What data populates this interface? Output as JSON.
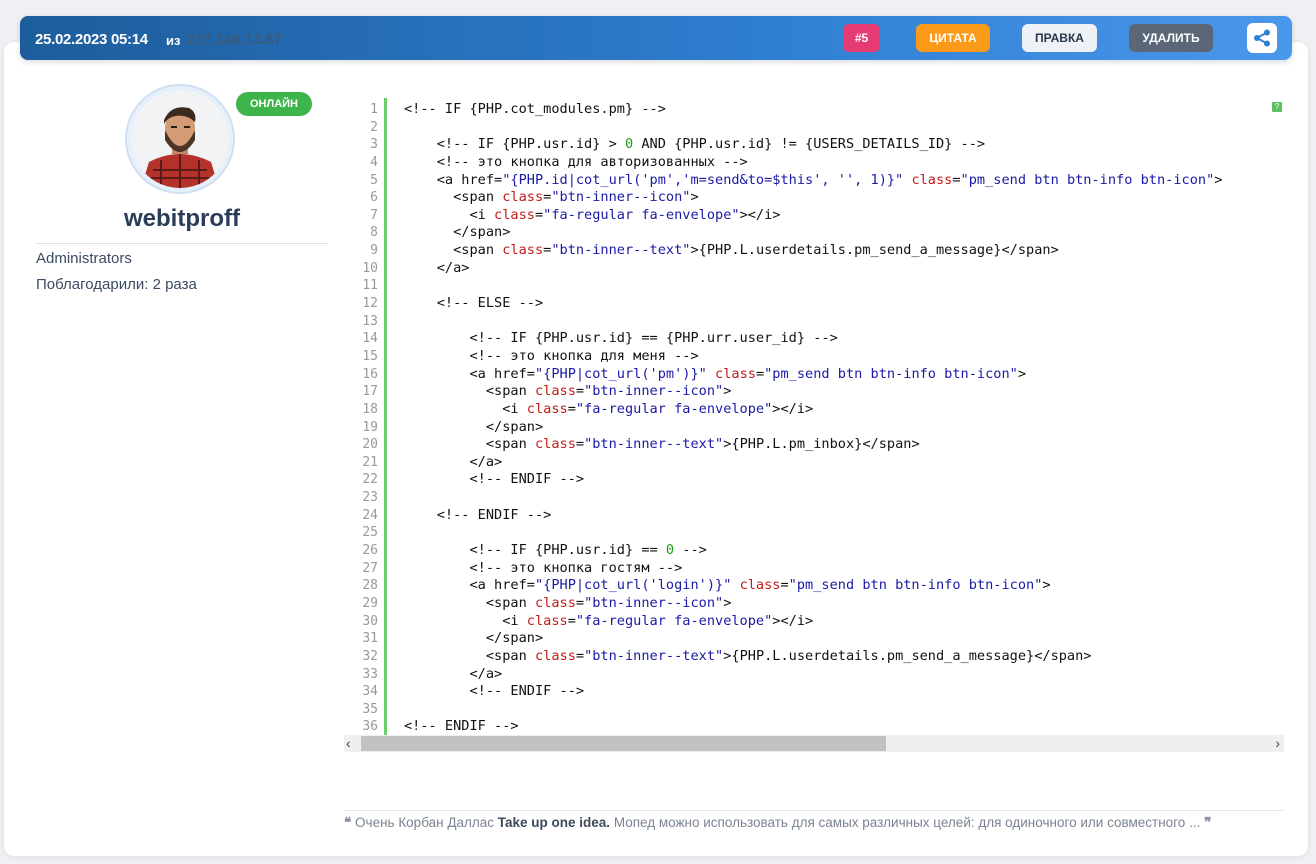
{
  "header": {
    "date": "25.02.2023 05:14",
    "from_label": "из",
    "ip": "217.146.13.87",
    "buttons": {
      "post_number": "#5",
      "quote": "ЦИТАТА",
      "edit": "ПРАВКА",
      "delete": "УДАЛИТЬ"
    },
    "share_icon": "share-icon"
  },
  "user": {
    "status": "ОНЛАЙН",
    "name": "webitproff",
    "group": "Administrators",
    "thanks": "Поблагодарили: 2 раза"
  },
  "code": {
    "line_numbers": [
      "1",
      "2",
      "3",
      "4",
      "5",
      "6",
      "7",
      "8",
      "9",
      "10",
      "11",
      "12",
      "13",
      "14",
      "15",
      "16",
      "17",
      "18",
      "19",
      "20",
      "21",
      "22",
      "23",
      "24",
      "25",
      "26",
      "27",
      "28",
      "29",
      "30",
      "31",
      "32",
      "33",
      "34",
      "35",
      "36"
    ],
    "help_icon": "?",
    "lines": [
      "<!-- IF {PHP.cot_modules.pm} -->",
      "",
      "    <!-- IF {PHP.usr.id} > 0 AND {PHP.usr.id} != {USERS_DETAILS_ID} -->",
      "    <!-- это кнопка для авторизованных -->",
      "    <a href=\"{PHP.id|cot_url('pm','m=send&to=$this', '', 1)}\" class=\"pm_send btn btn-info btn-icon\">",
      "      <span class=\"btn-inner--icon\">",
      "        <i class=\"fa-regular fa-envelope\"></i>",
      "      </span>",
      "      <span class=\"btn-inner--text\">{PHP.L.userdetails.pm_send_a_message}</span>",
      "    </a>",
      "",
      "    <!-- ELSE -->",
      "",
      "        <!-- IF {PHP.usr.id} == {PHP.urr.user_id} -->",
      "        <!-- это кнопка для меня -->",
      "        <a href=\"{PHP|cot_url('pm')}\" class=\"pm_send btn btn-info btn-icon\">",
      "          <span class=\"btn-inner--icon\">",
      "            <i class=\"fa-regular fa-envelope\"></i>",
      "          </span>",
      "          <span class=\"btn-inner--text\">{PHP.L.pm_inbox}</span>",
      "        </a>",
      "        <!-- ENDIF -->",
      "",
      "    <!-- ENDIF -->",
      "",
      "        <!-- IF {PHP.usr.id} == 0 -->",
      "        <!-- это кнопка гостям -->",
      "        <a href=\"{PHP|cot_url('login')}\" class=\"pm_send btn btn-info btn-icon\">",
      "          <span class=\"btn-inner--icon\">",
      "            <i class=\"fa-regular fa-envelope\"></i>",
      "          </span>",
      "          <span class=\"btn-inner--text\">{PHP.L.userdetails.pm_send_a_message}</span>",
      "        </a>",
      "        <!-- ENDIF -->",
      "",
      "<!-- ENDIF -->"
    ]
  },
  "signature": {
    "open_quote": "❝",
    "prefix": "Очень Корбан Даллас",
    "bold": "Take up one idea.",
    "rest": "Мопед можно использовать для самых различных целей: для одиночного или совместного ...",
    "close_quote": "❞"
  },
  "colors": {
    "header_gradient_start": "#1d5d9b",
    "header_gradient_end": "#4a98ec",
    "online": "#3db54a",
    "number_badge": "#e63a72",
    "quote_button": "#fb9a19",
    "delete_button": "#5b6776",
    "gutter_bar": "#6ccf6c"
  }
}
